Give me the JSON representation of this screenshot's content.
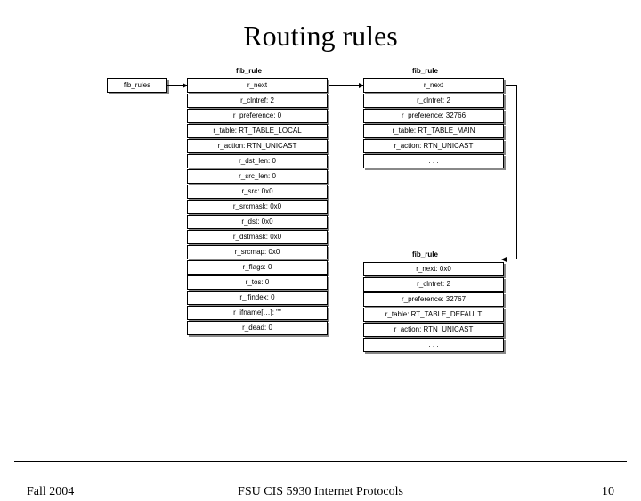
{
  "title": "Routing rules",
  "footer": {
    "left": "Fall 2004",
    "center": "FSU CIS 5930 Internet Protocols",
    "page": "10"
  },
  "labels": {
    "fib_rules": "fib_rules",
    "fib_rule_a": "fib_rule",
    "fib_rule_b": "fib_rule",
    "fib_rule_c": "fib_rule"
  },
  "colA": {
    "r_next": "r_next",
    "r_clntref": "r_clntref: 2",
    "r_preference": "r_preference: 0",
    "r_table": "r_table: RT_TABLE_LOCAL",
    "r_action": "r_action: RTN_UNICAST",
    "r_dst_len": "r_dst_len: 0",
    "r_src_len": "r_src_len: 0",
    "r_src": "r_src: 0x0",
    "r_srcmask": "r_srcmask: 0x0",
    "r_dst": "r_dst: 0x0",
    "r_dstmask": "r_dstmask: 0x0",
    "r_srcmap": "r_srcmap: 0x0",
    "r_flags": "r_flags: 0",
    "r_tos": "r_tos: 0",
    "r_ifindex": "r_ifindex: 0",
    "r_ifname": "r_ifname[…]: \"\"",
    "r_dead": "r_dead: 0"
  },
  "colB": {
    "r_next": "r_next",
    "r_clntref": "r_clntref: 2",
    "r_preference": "r_preference: 32766",
    "r_table": "r_table: RT_TABLE_MAIN",
    "r_action": "r_action: RTN_UNICAST",
    "dots": ". . ."
  },
  "colC": {
    "r_next": "r_next: 0x0",
    "r_clntref": "r_clntref: 2",
    "r_preference": "r_preference: 32767",
    "r_table": "r_table: RT_TABLE_DEFAULT",
    "r_action": "r_action: RTN_UNICAST",
    "dots": ". . ."
  }
}
